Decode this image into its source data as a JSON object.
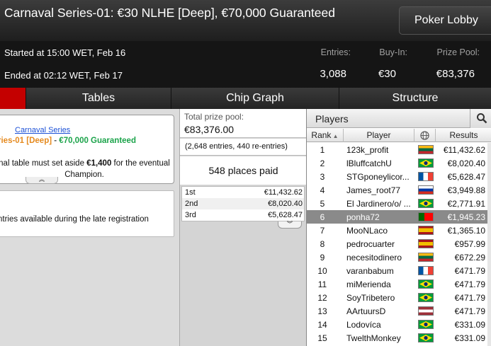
{
  "header": {
    "title": "Carnaval Series-01: €30 NLHE [Deep], €70,000 Guaranteed",
    "lobby_button": "Poker Lobby",
    "started": "Started at 15:00 WET, Feb 16",
    "ended": "Ended at 02:12 WET, Feb 17",
    "stats": [
      {
        "label": "Entries:",
        "value": "3,088"
      },
      {
        "label": "Buy-In:",
        "value": "€30"
      },
      {
        "label": "Prize Pool:",
        "value": "€83,376"
      }
    ]
  },
  "tabs": {
    "first": "",
    "tables": "Tables",
    "chip_graph": "Chip Graph",
    "structure": "Structure"
  },
  "info": {
    "series_link": "Carnaval Series",
    "series_name": "ries-01 [Deep]",
    "series_dash": " - ",
    "series_guarantee": "€70,000 Guaranteed",
    "notice_pre": "nal table must set aside ",
    "notice_amount": "€1,400",
    "notice_post": " for the eventual",
    "notice_line2": "Champion.",
    "late_reg": "ntries available during the late registration"
  },
  "prize": {
    "label": "Total prize pool:",
    "value": "€83,376.00",
    "entries": "(2,648 entries, 440 re-entries)",
    "places_paid": "548 places paid",
    "payouts": [
      {
        "place": "1st",
        "amount": "€11,432.62"
      },
      {
        "place": "2nd",
        "amount": "€8,020.40"
      },
      {
        "place": "3rd",
        "amount": "€5,628.47"
      }
    ]
  },
  "players": {
    "title": "Players",
    "columns": {
      "rank": "Rank",
      "player": "Player",
      "results": "Results"
    },
    "flag_colors": {
      "lithuania": [
        "#fdb913",
        "#006a44",
        "#c1272d"
      ],
      "brazil": [
        "#009c3b",
        "#ffdf00",
        "#002776"
      ],
      "france": [
        "#0055a4",
        "#ffffff",
        "#ef4135"
      ],
      "russia": [
        "#ffffff",
        "#0039a6",
        "#d52b1e"
      ],
      "spain": [
        "#aa151b",
        "#f1bf00",
        "#aa151b"
      ],
      "portugal": [
        "#006600",
        "#ff0000",
        "#ff0000"
      ],
      "latvia": [
        "#9e3039",
        "#ffffff",
        "#9e3039"
      ]
    },
    "rows": [
      {
        "rank": "1",
        "name": "123k_profit",
        "flag": "lithuania",
        "result": "€11,432.62"
      },
      {
        "rank": "2",
        "name": "lBluffcatchU",
        "flag": "brazil",
        "result": "€8,020.40"
      },
      {
        "rank": "3",
        "name": "STGponeylicor...",
        "flag": "france",
        "result": "€5,628.47"
      },
      {
        "rank": "4",
        "name": "James_root77",
        "flag": "russia",
        "result": "€3,949.88"
      },
      {
        "rank": "5",
        "name": "El Jardinero/o/ ...",
        "flag": "brazil",
        "result": "€2,771.91"
      },
      {
        "rank": "6",
        "name": "ponha72",
        "flag": "portugal",
        "result": "€1,945.23",
        "selected": true
      },
      {
        "rank": "7",
        "name": "MooNLaco",
        "flag": "spain",
        "result": "€1,365.10"
      },
      {
        "rank": "8",
        "name": "pedrocuarter",
        "flag": "spain",
        "result": "€957.99"
      },
      {
        "rank": "9",
        "name": "necesitodinero",
        "flag": "lithuania",
        "result": "€672.29"
      },
      {
        "rank": "10",
        "name": "varanbabum",
        "flag": "france",
        "result": "€471.79"
      },
      {
        "rank": "11",
        "name": "miMerienda",
        "flag": "brazil",
        "result": "€471.79"
      },
      {
        "rank": "12",
        "name": "SoyTribetero",
        "flag": "brazil",
        "result": "€471.79"
      },
      {
        "rank": "13",
        "name": "AArtuursD",
        "flag": "latvia",
        "result": "€471.79"
      },
      {
        "rank": "14",
        "name": "Lodovíca",
        "flag": "brazil",
        "result": "€331.09"
      },
      {
        "rank": "15",
        "name": "TwelthMonkey",
        "flag": "brazil",
        "result": "€331.09"
      }
    ]
  }
}
